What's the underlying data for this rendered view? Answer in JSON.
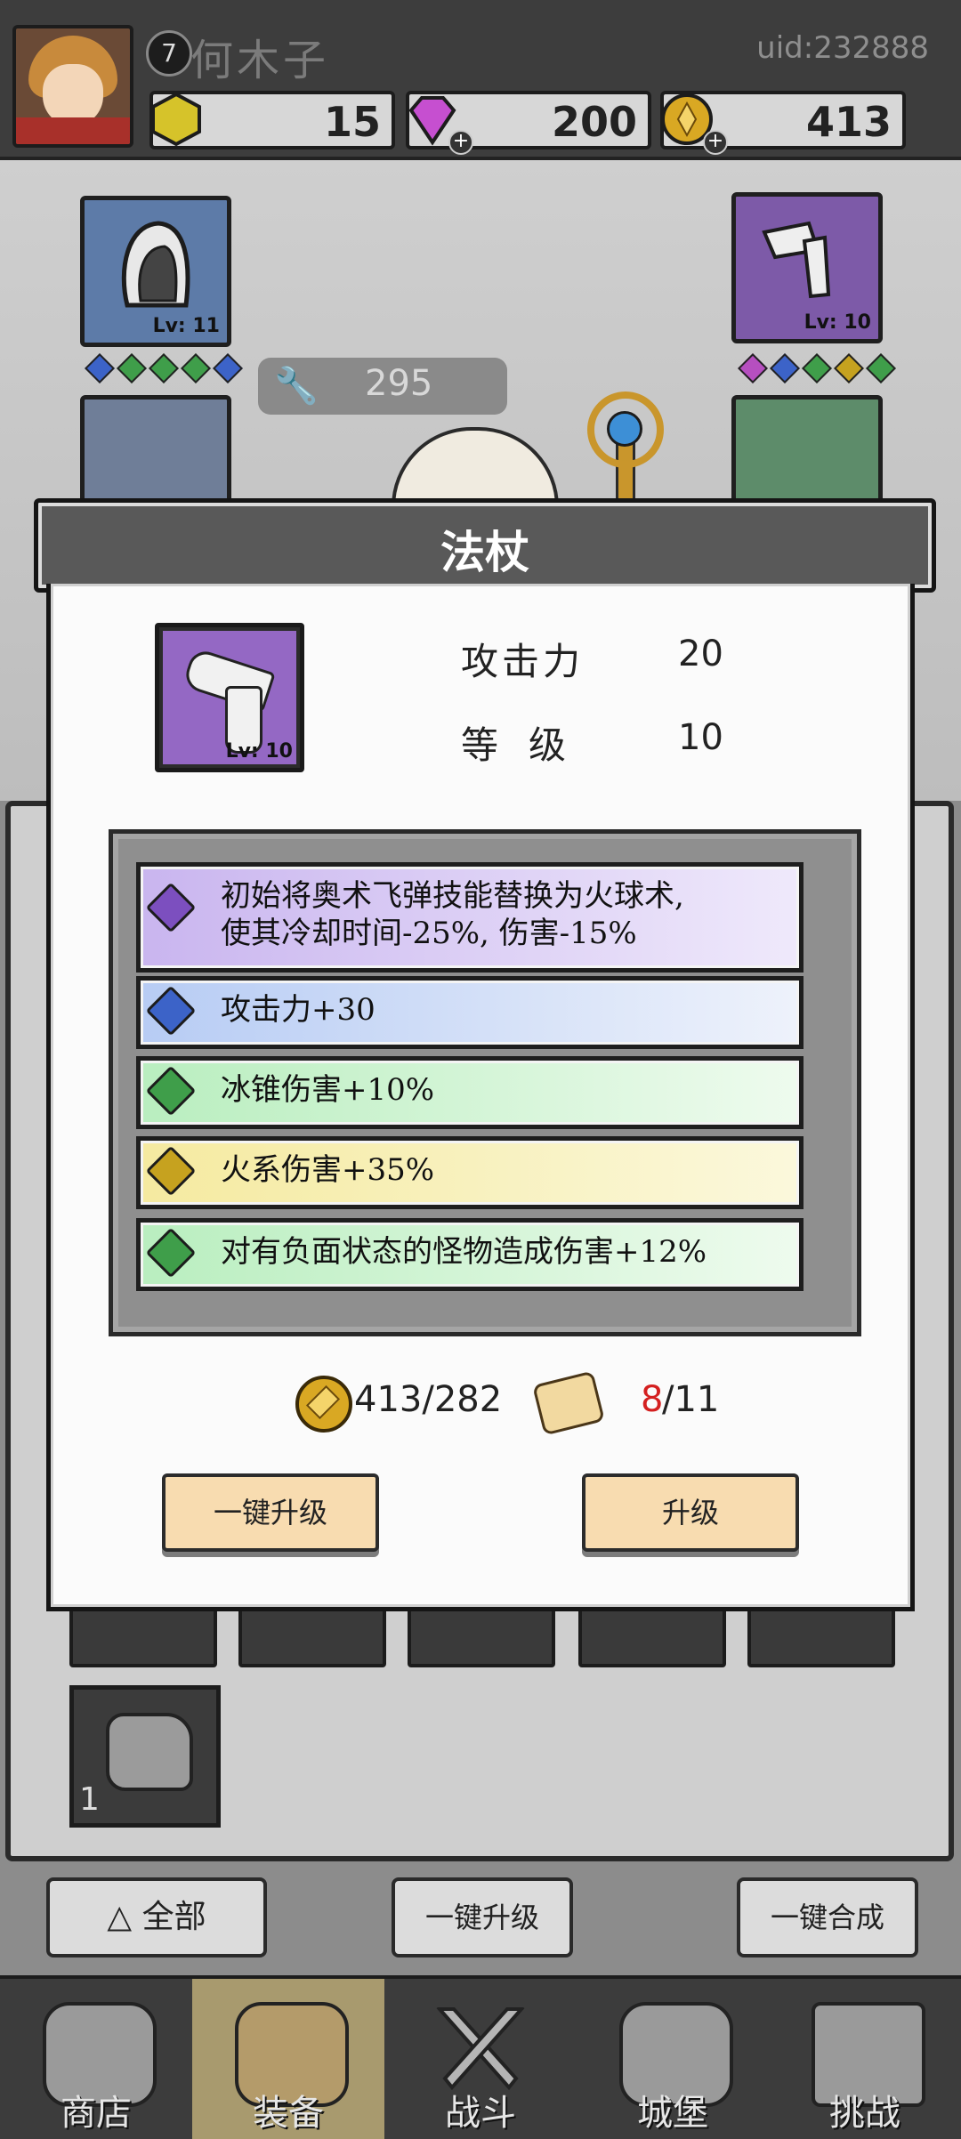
{
  "player": {
    "level": "7",
    "name": "何木子",
    "uid": "uid:232888"
  },
  "resources": {
    "hex_gem": "15",
    "diamond": "200",
    "coin": "413"
  },
  "hero_panel": {
    "power": "295",
    "helmet_level": "Lv: 11",
    "weapon_level": "Lv: 10",
    "left_gem_colors": [
      "#3c63c8",
      "#3f9e4a",
      "#3f9e4a",
      "#3f9e4a",
      "#3c63c8"
    ],
    "right_gem_colors": [
      "#b64fc0",
      "#3c63c8",
      "#3f9e4a",
      "#c6a21f",
      "#3f9e4a"
    ]
  },
  "dialog": {
    "title": "法杖",
    "item_level_badge": "Lv: 10",
    "attack_label": "攻击力",
    "attack_value": "20",
    "level_label": "等级",
    "level_value": "10",
    "affixes": [
      {
        "gem": "purple",
        "line1": "初始将奥术飞弹技能替换为火球术,",
        "line2": "使其冷却时间-25%, 伤害-15%"
      },
      {
        "gem": "blue",
        "line1": "攻击力+30"
      },
      {
        "gem": "green",
        "line1": "冰锥伤害+10%"
      },
      {
        "gem": "gold",
        "line1": "火系伤害+35%"
      },
      {
        "gem": "green",
        "line1": "对有负面状态的怪物造成伤害+12%"
      }
    ],
    "gold_cost": "413/282",
    "scroll_have": "8",
    "scroll_need": "/11",
    "quick_upgrade_label": "一键升级",
    "upgrade_label": "升级"
  },
  "inventory": {
    "rock_count": "1"
  },
  "actions": {
    "all_label": "全部",
    "upgrade_all_label": "一键升级",
    "merge_all_label": "一键合成"
  },
  "nav": {
    "shop": "商店",
    "equipment": "装备",
    "battle": "战斗",
    "castle": "城堡",
    "challenge": "挑战"
  },
  "colors": {
    "red_count": "#d42020",
    "button_fill": "#f8dcb0"
  }
}
